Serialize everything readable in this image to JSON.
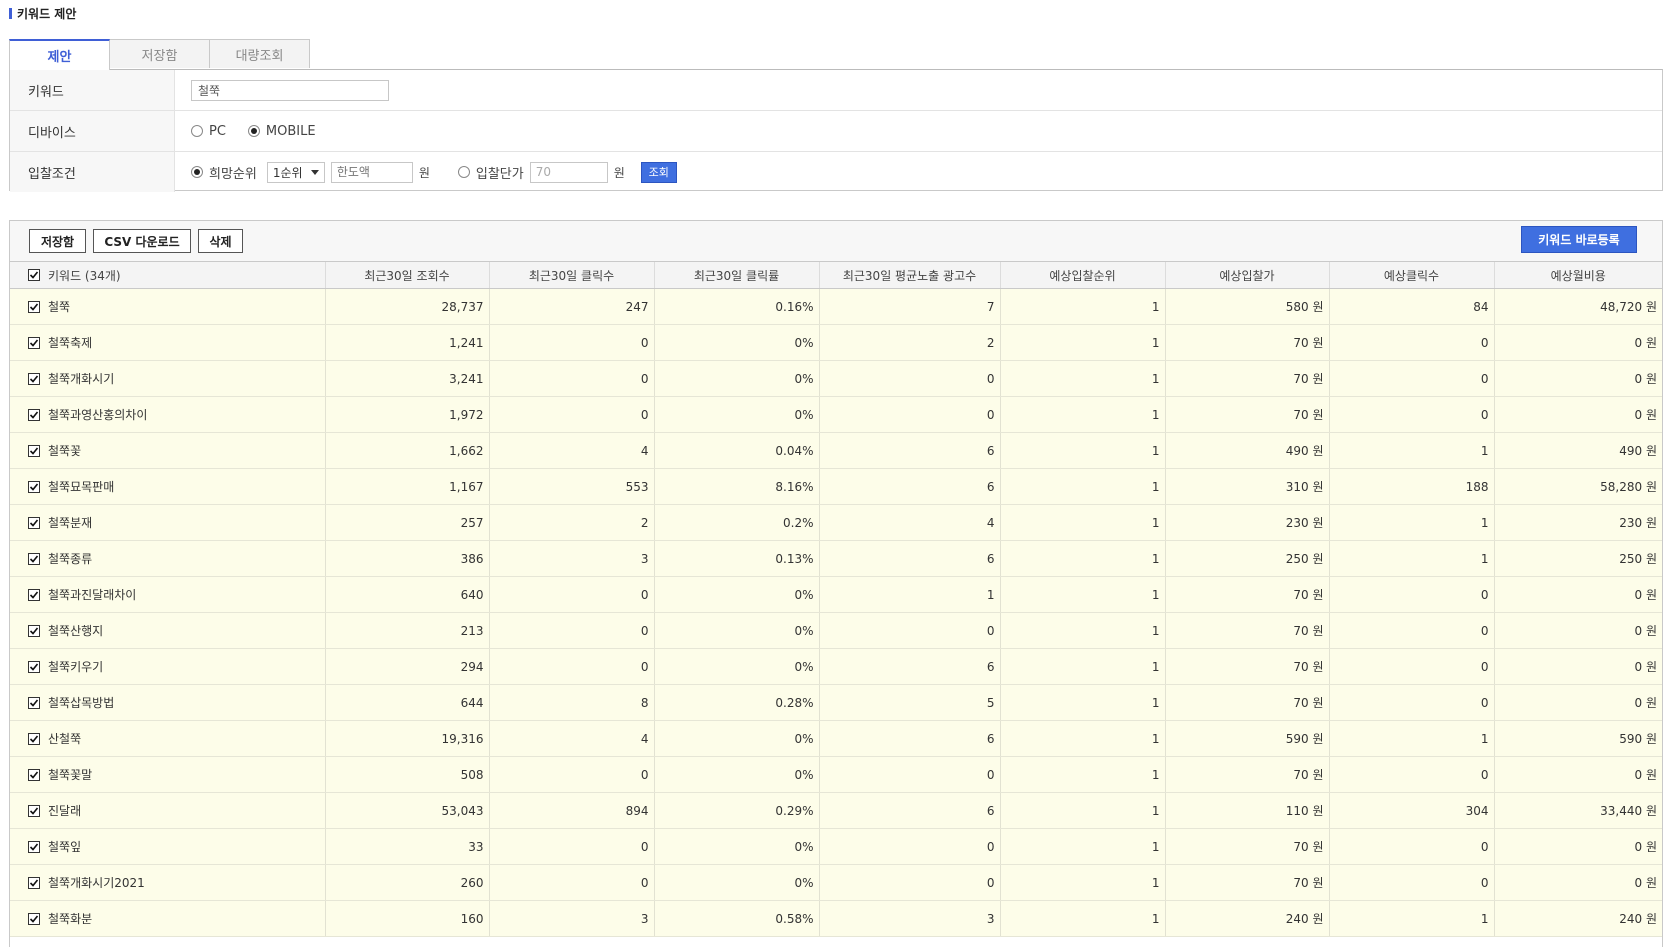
{
  "title": "키워드 제안",
  "tabs": [
    {
      "label": "제안"
    },
    {
      "label": "저장함"
    },
    {
      "label": "대량조회"
    }
  ],
  "form": {
    "keyword_label": "키워드",
    "keyword_value": "철쭉",
    "device_label": "디바이스",
    "device_options": [
      "PC",
      "MOBILE"
    ],
    "device_selected": "MOBILE",
    "bid_label": "입찰조건",
    "rank_radio_label": "희망순위",
    "rank_select": "1순위",
    "limit_placeholder": "한도액",
    "unit": "원",
    "price_radio_label": "입찰단가",
    "price_value": "70",
    "search_button": "조회"
  },
  "toolbar": {
    "save_button": "저장함",
    "csv_button": "CSV 다운로드",
    "delete_button": "삭제",
    "register_button": "키워드 바로등록"
  },
  "table": {
    "headers": [
      "키워드 (34개)",
      "최근30일 조회수",
      "최근30일 클릭수",
      "최근30일 클릭률",
      "최근30일 평균노출 광고수",
      "예상입찰순위",
      "예상입찰가",
      "예상클릭수",
      "예상월비용"
    ],
    "rows": [
      [
        "철쭉",
        "28,737",
        "247",
        "0.16%",
        "7",
        "1",
        "580 원",
        "84",
        "48,720 원"
      ],
      [
        "철쭉축제",
        "1,241",
        "0",
        "0%",
        "2",
        "1",
        "70 원",
        "0",
        "0 원"
      ],
      [
        "철쭉개화시기",
        "3,241",
        "0",
        "0%",
        "0",
        "1",
        "70 원",
        "0",
        "0 원"
      ],
      [
        "철쭉과영산홍의차이",
        "1,972",
        "0",
        "0%",
        "0",
        "1",
        "70 원",
        "0",
        "0 원"
      ],
      [
        "철쭉꽃",
        "1,662",
        "4",
        "0.04%",
        "6",
        "1",
        "490 원",
        "1",
        "490 원"
      ],
      [
        "철쭉묘목판매",
        "1,167",
        "553",
        "8.16%",
        "6",
        "1",
        "310 원",
        "188",
        "58,280 원"
      ],
      [
        "철쭉분재",
        "257",
        "2",
        "0.2%",
        "4",
        "1",
        "230 원",
        "1",
        "230 원"
      ],
      [
        "철쭉종류",
        "386",
        "3",
        "0.13%",
        "6",
        "1",
        "250 원",
        "1",
        "250 원"
      ],
      [
        "철쭉과진달래차이",
        "640",
        "0",
        "0%",
        "1",
        "1",
        "70 원",
        "0",
        "0 원"
      ],
      [
        "철쭉산행지",
        "213",
        "0",
        "0%",
        "0",
        "1",
        "70 원",
        "0",
        "0 원"
      ],
      [
        "철쭉키우기",
        "294",
        "0",
        "0%",
        "6",
        "1",
        "70 원",
        "0",
        "0 원"
      ],
      [
        "철쭉삽목방법",
        "644",
        "8",
        "0.28%",
        "5",
        "1",
        "70 원",
        "0",
        "0 원"
      ],
      [
        "산철쭉",
        "19,316",
        "4",
        "0%",
        "6",
        "1",
        "590 원",
        "1",
        "590 원"
      ],
      [
        "철쭉꽃말",
        "508",
        "0",
        "0%",
        "0",
        "1",
        "70 원",
        "0",
        "0 원"
      ],
      [
        "진달래",
        "53,043",
        "894",
        "0.29%",
        "6",
        "1",
        "110 원",
        "304",
        "33,440 원"
      ],
      [
        "철쭉잎",
        "33",
        "0",
        "0%",
        "0",
        "1",
        "70 원",
        "0",
        "0 원"
      ],
      [
        "철쭉개화시기2021",
        "260",
        "0",
        "0%",
        "0",
        "1",
        "70 원",
        "0",
        "0 원"
      ],
      [
        "철쭉화분",
        "160",
        "3",
        "0.58%",
        "3",
        "1",
        "240 원",
        "1",
        "240 원"
      ]
    ]
  },
  "icons": {
    "checkbox": "checkbox-checked-icon",
    "radio": "radio-icon",
    "dropdown": "chevron-down-icon"
  },
  "colors": {
    "accent": "#3f6fe0",
    "row_bg": "#fdfde9"
  }
}
